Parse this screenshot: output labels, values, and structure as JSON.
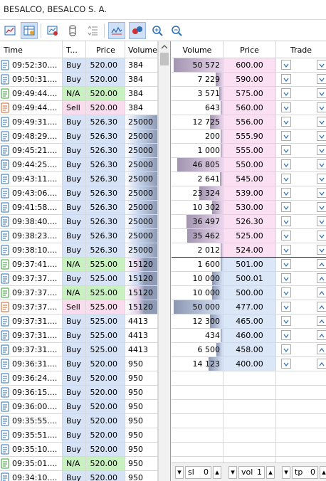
{
  "window": {
    "title": "BESALCO, BESALCO S. A."
  },
  "toolbar": {
    "buttons": [
      {
        "name": "chart-icon"
      },
      {
        "name": "depth-table-icon"
      },
      {
        "name": "trade-ticket-icon"
      },
      {
        "name": "cylinder-icon"
      },
      {
        "name": "sort-icon"
      },
      {
        "name": "tick-chart-icon"
      },
      {
        "name": "dots-icon"
      },
      {
        "name": "zoom-in-icon"
      },
      {
        "name": "zoom-out-icon"
      }
    ]
  },
  "trades": {
    "headers": {
      "time": "Time",
      "type": "T...",
      "price": "Price",
      "volume": "Volume"
    },
    "rows": [
      {
        "time": "09:52:30....",
        "type": "Buy",
        "price": "520.00",
        "volume": "384",
        "icon": "blue"
      },
      {
        "time": "09:50:31....",
        "type": "Buy",
        "price": "520.00",
        "volume": "384",
        "icon": "blue"
      },
      {
        "time": "09:49:44....",
        "type": "N/A",
        "price": "520.00",
        "volume": "384",
        "icon": "green"
      },
      {
        "time": "09:49:44....",
        "type": "Sell",
        "price": "520.00",
        "volume": "384",
        "icon": "red"
      },
      {
        "time": "09:49:31....",
        "type": "Buy",
        "price": "526.30",
        "volume": "25000",
        "icon": "blue"
      },
      {
        "time": "09:48:29....",
        "type": "Buy",
        "price": "526.30",
        "volume": "25000",
        "icon": "blue"
      },
      {
        "time": "09:45:21....",
        "type": "Buy",
        "price": "526.30",
        "volume": "25000",
        "icon": "blue"
      },
      {
        "time": "09:44:25....",
        "type": "Buy",
        "price": "526.30",
        "volume": "25000",
        "icon": "blue"
      },
      {
        "time": "09:43:11....",
        "type": "Buy",
        "price": "526.30",
        "volume": "25000",
        "icon": "blue"
      },
      {
        "time": "09:43:06....",
        "type": "Buy",
        "price": "526.30",
        "volume": "25000",
        "icon": "blue"
      },
      {
        "time": "09:41:58....",
        "type": "Buy",
        "price": "526.30",
        "volume": "25000",
        "icon": "blue"
      },
      {
        "time": "09:38:40....",
        "type": "Buy",
        "price": "526.30",
        "volume": "25000",
        "icon": "blue"
      },
      {
        "time": "09:38:23....",
        "type": "Buy",
        "price": "526.30",
        "volume": "25000",
        "icon": "blue"
      },
      {
        "time": "09:38:10....",
        "type": "Buy",
        "price": "526.30",
        "volume": "25000",
        "icon": "blue"
      },
      {
        "time": "09:37:41....",
        "type": "N/A",
        "price": "525.00",
        "volume": "15120",
        "icon": "green"
      },
      {
        "time": "09:37:37....",
        "type": "Buy",
        "price": "525.00",
        "volume": "15120",
        "icon": "blue"
      },
      {
        "time": "09:37:37....",
        "type": "N/A",
        "price": "525.00",
        "volume": "15120",
        "icon": "green"
      },
      {
        "time": "09:37:37....",
        "type": "Sell",
        "price": "525.00",
        "volume": "15120",
        "icon": "red"
      },
      {
        "time": "09:37:31....",
        "type": "Buy",
        "price": "525.00",
        "volume": "4413",
        "icon": "blue"
      },
      {
        "time": "09:37:31....",
        "type": "Buy",
        "price": "525.00",
        "volume": "4413",
        "icon": "blue"
      },
      {
        "time": "09:37:31....",
        "type": "Buy",
        "price": "525.00",
        "volume": "4413",
        "icon": "blue"
      },
      {
        "time": "09:36:31....",
        "type": "Buy",
        "price": "520.00",
        "volume": "950",
        "icon": "blue"
      },
      {
        "time": "09:36:24....",
        "type": "Buy",
        "price": "520.00",
        "volume": "950",
        "icon": "blue"
      },
      {
        "time": "09:36:15....",
        "type": "Buy",
        "price": "520.00",
        "volume": "950",
        "icon": "blue"
      },
      {
        "time": "09:36:00....",
        "type": "Buy",
        "price": "520.00",
        "volume": "950",
        "icon": "blue"
      },
      {
        "time": "09:35:55....",
        "type": "Buy",
        "price": "520.00",
        "volume": "950",
        "icon": "blue"
      },
      {
        "time": "09:35:51....",
        "type": "Buy",
        "price": "520.00",
        "volume": "950",
        "icon": "blue"
      },
      {
        "time": "09:35:10....",
        "type": "Buy",
        "price": "520.00",
        "volume": "950",
        "icon": "blue"
      },
      {
        "time": "09:35:01....",
        "type": "N/A",
        "price": "520.00",
        "volume": "950",
        "icon": "green"
      },
      {
        "time": "09:34:10....",
        "type": "Buy",
        "price": "520.00",
        "volume": "950",
        "icon": "blue"
      }
    ]
  },
  "depth": {
    "headers": {
      "volume": "Volume",
      "price": "Price",
      "trade": "Trade"
    },
    "asks": [
      {
        "volume": "50 572",
        "price": "600.00",
        "fill": 0.95
      },
      {
        "volume": "7 229",
        "price": "590.00",
        "fill": 0.14
      },
      {
        "volume": "3 571",
        "price": "575.00",
        "fill": 0.07
      },
      {
        "volume": "643",
        "price": "560.00",
        "fill": 0.02
      },
      {
        "volume": "12 725",
        "price": "556.00",
        "fill": 0.25
      },
      {
        "volume": "200",
        "price": "555.90",
        "fill": 0.01
      },
      {
        "volume": "1 000",
        "price": "555.00",
        "fill": 0.02
      },
      {
        "volume": "46 805",
        "price": "550.00",
        "fill": 0.88
      },
      {
        "volume": "2 641",
        "price": "545.00",
        "fill": 0.05
      },
      {
        "volume": "23 324",
        "price": "539.00",
        "fill": 0.45
      },
      {
        "volume": "10 302",
        "price": "530.00",
        "fill": 0.2
      },
      {
        "volume": "36 497",
        "price": "526.30",
        "fill": 0.7
      },
      {
        "volume": "35 462",
        "price": "525.00",
        "fill": 0.68
      },
      {
        "volume": "2 012",
        "price": "524.00",
        "fill": 0.04
      }
    ],
    "bids": [
      {
        "volume": "1 600",
        "price": "501.00",
        "fill": 0.03
      },
      {
        "volume": "10 000",
        "price": "500.01",
        "fill": 0.2
      },
      {
        "volume": "10 000",
        "price": "500.00",
        "fill": 0.2
      },
      {
        "volume": "50 000",
        "price": "477.00",
        "fill": 0.95
      },
      {
        "volume": "12 300",
        "price": "465.00",
        "fill": 0.24
      },
      {
        "volume": "434",
        "price": "460.00",
        "fill": 0.01
      },
      {
        "volume": "6 500",
        "price": "458.00",
        "fill": 0.13
      },
      {
        "volume": "14 123",
        "price": "400.00",
        "fill": 0.28
      }
    ],
    "empty_rows": 7
  },
  "bottom": {
    "sl_label": "sl",
    "sl_value": "0",
    "vol_label": "vol",
    "vol_value": "1",
    "tp_label": "tp",
    "tp_value": "0"
  }
}
